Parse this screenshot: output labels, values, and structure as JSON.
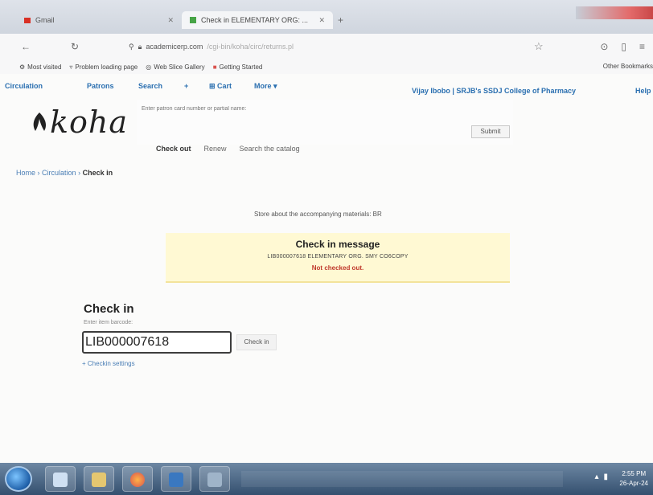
{
  "browser": {
    "tabs": [
      {
        "label": "Gmail",
        "active": false
      },
      {
        "label": "Check in ELEMENTARY ORG: ...",
        "active": true
      }
    ],
    "new_tab": "+",
    "url": "academicerp.com",
    "url_dim": "/cgi-bin/koha/circ/returns.pl",
    "bookmarks": [
      "Most visited",
      "Problem loading page",
      "Web Slice Gallery",
      "Getting Started"
    ],
    "other_bookmarks": "Other Bookmarks"
  },
  "koha": {
    "nav": [
      "Circulation",
      "Patrons",
      "Search",
      "+",
      "Cart",
      "More"
    ],
    "user_info": "Vijay Ibobo | SRJB's SSDJ College of Pharmacy",
    "help": "Help",
    "logo_text": "koha",
    "search_placeholder": "Enter patron card number or partial name:",
    "submit_label": "Submit",
    "search_tabs": [
      "Check out",
      "Renew",
      "Search the catalog"
    ],
    "breadcrumb": {
      "home": "Home",
      "sep": "›",
      "circulation": "Circulation",
      "current": "Check in"
    }
  },
  "main": {
    "store_note": "Store about the accompanying materials: BR",
    "message": {
      "title": "Check in message",
      "item": "LIB000007618 ELEMENTARY ORG. SMY CO6COPY",
      "status": "Not checked out."
    },
    "checkin": {
      "title": "Check in",
      "enter_label": "Enter item barcode:",
      "barcode_value": "LIB000007618",
      "button_label": "Check in",
      "settings_link": "+ Checkin settings"
    }
  },
  "taskbar": {
    "time": "2:55 PM",
    "date": "26-Apr-24"
  },
  "colors": {
    "link": "#2a6fb0",
    "message_bg": "#fff9d3",
    "status_red": "#c0392b"
  }
}
